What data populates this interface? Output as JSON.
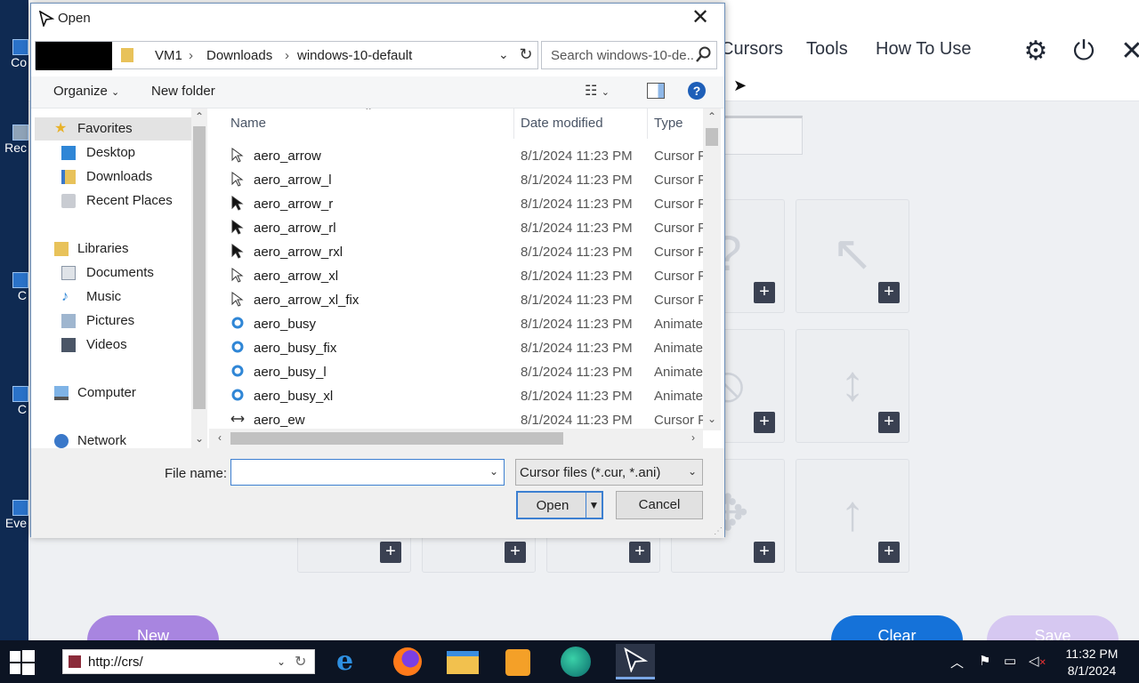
{
  "desktop": {
    "icons": [
      {
        "label": "Co",
        "name": "desktop-icon-1"
      },
      {
        "label": "Rec",
        "name": "desktop-icon-recycle"
      },
      {
        "label": "C",
        "name": "desktop-icon-3"
      },
      {
        "label": "C",
        "name": "desktop-icon-4"
      },
      {
        "label": "Eve",
        "name": "desktop-icon-5"
      }
    ]
  },
  "app": {
    "nav": {
      "cursors": "Cursors",
      "tools": "Tools",
      "how_to_use": "How To Use"
    },
    "buttons": {
      "new": "New",
      "clear": "Clear",
      "save": "Save"
    },
    "plus": "+"
  },
  "dialog": {
    "title": "Open",
    "close_glyph": "✕",
    "breadcrumbs": [
      "VM1",
      "Downloads",
      "windows-10-default"
    ],
    "crumb_sep": "›",
    "search_placeholder": "Search windows-10-de...",
    "toolbar": {
      "organize": "Organize",
      "new_folder": "New folder"
    },
    "nav_items": [
      {
        "label": "Favorites",
        "head": true,
        "selected": true,
        "icon": "star-icon"
      },
      {
        "label": "Desktop",
        "head": false,
        "icon": "desktop-folder-icon"
      },
      {
        "label": "Downloads",
        "head": false,
        "icon": "downloads-folder-icon"
      },
      {
        "label": "Recent Places",
        "head": false,
        "icon": "recent-places-icon"
      },
      {
        "label": "Libraries",
        "head": true,
        "icon": "libraries-icon"
      },
      {
        "label": "Documents",
        "head": false,
        "icon": "documents-icon"
      },
      {
        "label": "Music",
        "head": false,
        "icon": "music-icon"
      },
      {
        "label": "Pictures",
        "head": false,
        "icon": "pictures-icon"
      },
      {
        "label": "Videos",
        "head": false,
        "icon": "videos-icon"
      },
      {
        "label": "Computer",
        "head": true,
        "icon": "computer-icon"
      },
      {
        "label": "Network",
        "head": true,
        "icon": "network-icon"
      }
    ],
    "columns": {
      "name": "Name",
      "date": "Date modified",
      "type": "Type"
    },
    "files": [
      {
        "name": "aero_arrow",
        "date": "8/1/2024 11:23 PM",
        "type": "Cursor File",
        "icon": "cursor-icon"
      },
      {
        "name": "aero_arrow_l",
        "date": "8/1/2024 11:23 PM",
        "type": "Cursor File",
        "icon": "cursor-icon"
      },
      {
        "name": "aero_arrow_r",
        "date": "8/1/2024 11:23 PM",
        "type": "Cursor File",
        "icon": "cursor-icon"
      },
      {
        "name": "aero_arrow_rl",
        "date": "8/1/2024 11:23 PM",
        "type": "Cursor File",
        "icon": "cursor-icon"
      },
      {
        "name": "aero_arrow_rxl",
        "date": "8/1/2024 11:23 PM",
        "type": "Cursor File",
        "icon": "cursor-icon"
      },
      {
        "name": "aero_arrow_xl",
        "date": "8/1/2024 11:23 PM",
        "type": "Cursor File",
        "icon": "cursor-icon"
      },
      {
        "name": "aero_arrow_xl_fix",
        "date": "8/1/2024 11:23 PM",
        "type": "Cursor File",
        "icon": "cursor-icon"
      },
      {
        "name": "aero_busy",
        "date": "8/1/2024 11:23 PM",
        "type": "Animated Cursor",
        "icon": "busy-cursor-icon"
      },
      {
        "name": "aero_busy_fix",
        "date": "8/1/2024 11:23 PM",
        "type": "Animated Cursor",
        "icon": "busy-cursor-icon"
      },
      {
        "name": "aero_busy_l",
        "date": "8/1/2024 11:23 PM",
        "type": "Animated Cursor",
        "icon": "busy-cursor-icon"
      },
      {
        "name": "aero_busy_xl",
        "date": "8/1/2024 11:23 PM",
        "type": "Animated Cursor",
        "icon": "busy-cursor-icon"
      },
      {
        "name": "aero_ew",
        "date": "8/1/2024 11:23 PM",
        "type": "Cursor File",
        "icon": "ew-resize-cursor-icon"
      }
    ],
    "file_name_label": "File name:",
    "file_name_value": "",
    "file_type": "Cursor files (*.cur, *.ani)",
    "open_button": "Open",
    "cancel_button": "Cancel"
  },
  "taskbar": {
    "url": "http://crs/",
    "time": "11:32 PM",
    "date": "8/1/2024"
  },
  "colors": {
    "accent": "#3c7fd1",
    "new_button": "#a885e0",
    "clear_button": "#1572d9",
    "save_button": "#d6c8f1"
  }
}
